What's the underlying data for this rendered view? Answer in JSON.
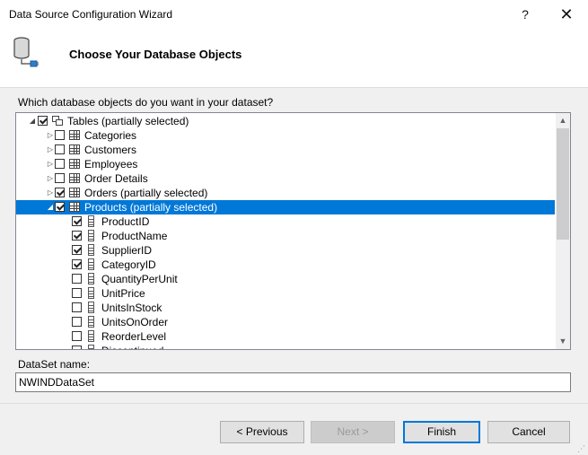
{
  "window": {
    "title": "Data Source Configuration Wizard",
    "help_glyph": "?",
    "close_glyph": "✕"
  },
  "header": {
    "title": "Choose Your Database Objects",
    "icon": "database-connection-icon"
  },
  "prompt": "Which database objects do you want in your dataset?",
  "tree": {
    "rows": [
      {
        "label": "Tables (partially selected)",
        "level": 0,
        "expander": "expanded",
        "checked": true,
        "icon": "tables-icon",
        "selected": false
      },
      {
        "label": "Categories",
        "level": 1,
        "expander": "collapsed",
        "checked": false,
        "icon": "table-icon",
        "selected": false
      },
      {
        "label": "Customers",
        "level": 1,
        "expander": "collapsed",
        "checked": false,
        "icon": "table-icon",
        "selected": false
      },
      {
        "label": "Employees",
        "level": 1,
        "expander": "collapsed",
        "checked": false,
        "icon": "table-icon",
        "selected": false
      },
      {
        "label": "Order Details",
        "level": 1,
        "expander": "collapsed",
        "checked": false,
        "icon": "table-icon",
        "selected": false
      },
      {
        "label": "Orders (partially selected)",
        "level": 1,
        "expander": "collapsed",
        "checked": true,
        "icon": "table-icon",
        "selected": false
      },
      {
        "label": "Products (partially selected)",
        "level": 1,
        "expander": "expanded",
        "checked": true,
        "icon": "table-icon",
        "selected": true
      },
      {
        "label": "ProductID",
        "level": 2,
        "expander": "none",
        "checked": true,
        "icon": "column-icon",
        "selected": false
      },
      {
        "label": "ProductName",
        "level": 2,
        "expander": "none",
        "checked": true,
        "icon": "column-icon",
        "selected": false
      },
      {
        "label": "SupplierID",
        "level": 2,
        "expander": "none",
        "checked": true,
        "icon": "column-icon",
        "selected": false
      },
      {
        "label": "CategoryID",
        "level": 2,
        "expander": "none",
        "checked": true,
        "icon": "column-icon",
        "selected": false
      },
      {
        "label": "QuantityPerUnit",
        "level": 2,
        "expander": "none",
        "checked": false,
        "icon": "column-icon",
        "selected": false
      },
      {
        "label": "UnitPrice",
        "level": 2,
        "expander": "none",
        "checked": false,
        "icon": "column-icon",
        "selected": false
      },
      {
        "label": "UnitsInStock",
        "level": 2,
        "expander": "none",
        "checked": false,
        "icon": "column-icon",
        "selected": false
      },
      {
        "label": "UnitsOnOrder",
        "level": 2,
        "expander": "none",
        "checked": false,
        "icon": "column-icon",
        "selected": false
      },
      {
        "label": "ReorderLevel",
        "level": 2,
        "expander": "none",
        "checked": false,
        "icon": "column-icon",
        "selected": false
      },
      {
        "label": "Discontinued",
        "level": 2,
        "expander": "none",
        "checked": false,
        "icon": "column-icon",
        "selected": false
      }
    ]
  },
  "dataset": {
    "label": "DataSet name:",
    "value": "NWINDDataSet"
  },
  "buttons": {
    "previous": "< Previous",
    "next": "Next >",
    "finish": "Finish",
    "cancel": "Cancel"
  },
  "colors": {
    "selection": "#0078d7",
    "background": "#f0f0f0",
    "default_button_border": "#0078d7"
  }
}
